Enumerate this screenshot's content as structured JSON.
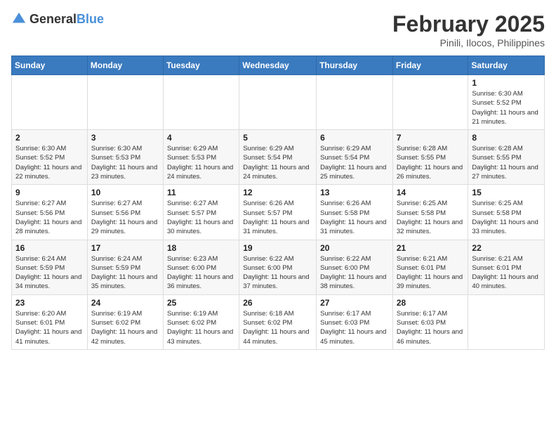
{
  "header": {
    "logo_general": "General",
    "logo_blue": "Blue",
    "month_year": "February 2025",
    "location": "Pinili, Ilocos, Philippines"
  },
  "days_of_week": [
    "Sunday",
    "Monday",
    "Tuesday",
    "Wednesday",
    "Thursday",
    "Friday",
    "Saturday"
  ],
  "weeks": [
    [
      {
        "day": "",
        "info": ""
      },
      {
        "day": "",
        "info": ""
      },
      {
        "day": "",
        "info": ""
      },
      {
        "day": "",
        "info": ""
      },
      {
        "day": "",
        "info": ""
      },
      {
        "day": "",
        "info": ""
      },
      {
        "day": "1",
        "info": "Sunrise: 6:30 AM\nSunset: 5:52 PM\nDaylight: 11 hours and 21 minutes."
      }
    ],
    [
      {
        "day": "2",
        "info": "Sunrise: 6:30 AM\nSunset: 5:52 PM\nDaylight: 11 hours and 22 minutes."
      },
      {
        "day": "3",
        "info": "Sunrise: 6:30 AM\nSunset: 5:53 PM\nDaylight: 11 hours and 23 minutes."
      },
      {
        "day": "4",
        "info": "Sunrise: 6:29 AM\nSunset: 5:53 PM\nDaylight: 11 hours and 24 minutes."
      },
      {
        "day": "5",
        "info": "Sunrise: 6:29 AM\nSunset: 5:54 PM\nDaylight: 11 hours and 24 minutes."
      },
      {
        "day": "6",
        "info": "Sunrise: 6:29 AM\nSunset: 5:54 PM\nDaylight: 11 hours and 25 minutes."
      },
      {
        "day": "7",
        "info": "Sunrise: 6:28 AM\nSunset: 5:55 PM\nDaylight: 11 hours and 26 minutes."
      },
      {
        "day": "8",
        "info": "Sunrise: 6:28 AM\nSunset: 5:55 PM\nDaylight: 11 hours and 27 minutes."
      }
    ],
    [
      {
        "day": "9",
        "info": "Sunrise: 6:27 AM\nSunset: 5:56 PM\nDaylight: 11 hours and 28 minutes."
      },
      {
        "day": "10",
        "info": "Sunrise: 6:27 AM\nSunset: 5:56 PM\nDaylight: 11 hours and 29 minutes."
      },
      {
        "day": "11",
        "info": "Sunrise: 6:27 AM\nSunset: 5:57 PM\nDaylight: 11 hours and 30 minutes."
      },
      {
        "day": "12",
        "info": "Sunrise: 6:26 AM\nSunset: 5:57 PM\nDaylight: 11 hours and 31 minutes."
      },
      {
        "day": "13",
        "info": "Sunrise: 6:26 AM\nSunset: 5:58 PM\nDaylight: 11 hours and 31 minutes."
      },
      {
        "day": "14",
        "info": "Sunrise: 6:25 AM\nSunset: 5:58 PM\nDaylight: 11 hours and 32 minutes."
      },
      {
        "day": "15",
        "info": "Sunrise: 6:25 AM\nSunset: 5:58 PM\nDaylight: 11 hours and 33 minutes."
      }
    ],
    [
      {
        "day": "16",
        "info": "Sunrise: 6:24 AM\nSunset: 5:59 PM\nDaylight: 11 hours and 34 minutes."
      },
      {
        "day": "17",
        "info": "Sunrise: 6:24 AM\nSunset: 5:59 PM\nDaylight: 11 hours and 35 minutes."
      },
      {
        "day": "18",
        "info": "Sunrise: 6:23 AM\nSunset: 6:00 PM\nDaylight: 11 hours and 36 minutes."
      },
      {
        "day": "19",
        "info": "Sunrise: 6:22 AM\nSunset: 6:00 PM\nDaylight: 11 hours and 37 minutes."
      },
      {
        "day": "20",
        "info": "Sunrise: 6:22 AM\nSunset: 6:00 PM\nDaylight: 11 hours and 38 minutes."
      },
      {
        "day": "21",
        "info": "Sunrise: 6:21 AM\nSunset: 6:01 PM\nDaylight: 11 hours and 39 minutes."
      },
      {
        "day": "22",
        "info": "Sunrise: 6:21 AM\nSunset: 6:01 PM\nDaylight: 11 hours and 40 minutes."
      }
    ],
    [
      {
        "day": "23",
        "info": "Sunrise: 6:20 AM\nSunset: 6:01 PM\nDaylight: 11 hours and 41 minutes."
      },
      {
        "day": "24",
        "info": "Sunrise: 6:19 AM\nSunset: 6:02 PM\nDaylight: 11 hours and 42 minutes."
      },
      {
        "day": "25",
        "info": "Sunrise: 6:19 AM\nSunset: 6:02 PM\nDaylight: 11 hours and 43 minutes."
      },
      {
        "day": "26",
        "info": "Sunrise: 6:18 AM\nSunset: 6:02 PM\nDaylight: 11 hours and 44 minutes."
      },
      {
        "day": "27",
        "info": "Sunrise: 6:17 AM\nSunset: 6:03 PM\nDaylight: 11 hours and 45 minutes."
      },
      {
        "day": "28",
        "info": "Sunrise: 6:17 AM\nSunset: 6:03 PM\nDaylight: 11 hours and 46 minutes."
      },
      {
        "day": "",
        "info": ""
      }
    ]
  ]
}
